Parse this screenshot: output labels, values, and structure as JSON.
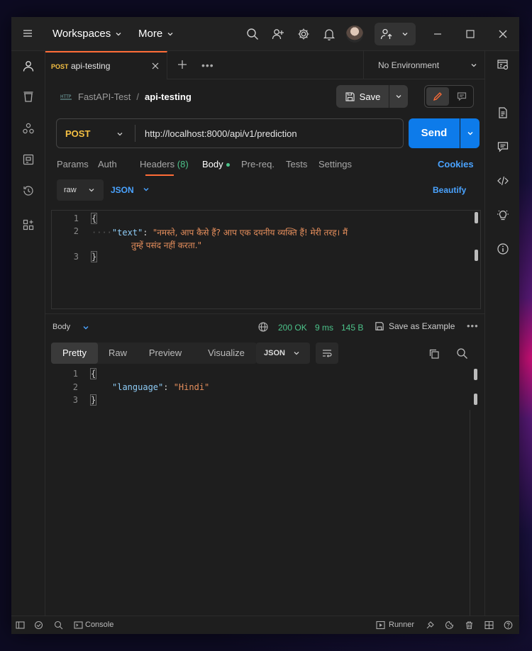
{
  "topbar": {
    "workspaces_label": "Workspaces",
    "more_label": "More"
  },
  "tab": {
    "method": "POST",
    "name": "api-testing"
  },
  "environment": {
    "label": "No Environment"
  },
  "breadcrumb": {
    "collection": "FastAPI-Test",
    "separator": "/",
    "request": "api-testing"
  },
  "toolbar": {
    "save_label": "Save"
  },
  "request": {
    "method": "POST",
    "url": "http://localhost:8000/api/v1/prediction",
    "send_label": "Send"
  },
  "request_tabs": {
    "params": "Params",
    "auth": "Auth",
    "headers": "Headers",
    "headers_count": "(8)",
    "body": "Body",
    "prereq": "Pre-req.",
    "tests": "Tests",
    "settings": "Settings",
    "cookies": "Cookies"
  },
  "body_options": {
    "mode": "raw",
    "format": "JSON",
    "beautify": "Beautify"
  },
  "request_body": {
    "line_numbers": [
      "1",
      "2",
      "3"
    ],
    "open_brace": "{",
    "close_brace": "}",
    "indent": "····",
    "key": "\"text\"",
    "colon": ": ",
    "value_line1": "\"नमस्ते, आप कैसे हैं? आप एक दयनीय व्यक्ति हैं! मेरी तरह। मैं",
    "value_line2": "तुम्हें पसंद नहीं करता.\""
  },
  "response": {
    "label": "Body",
    "status": "200 OK",
    "time": "9 ms",
    "size": "145 B",
    "save_example": "Save as Example",
    "tabs": [
      "Pretty",
      "Raw",
      "Preview",
      "Visualize"
    ],
    "format": "JSON",
    "line_numbers": [
      "1",
      "2",
      "3"
    ],
    "open_brace": "{",
    "close_brace": "}",
    "key": "\"language\"",
    "colon": ": ",
    "value": "\"Hindi\""
  },
  "statusbar": {
    "console": "Console",
    "runner": "Runner"
  },
  "colors": {
    "accent": "#ff6c37",
    "send": "#0d7bea",
    "method_post": "#f5c043",
    "ok": "#4cc38a",
    "link": "#4aa3ff"
  }
}
